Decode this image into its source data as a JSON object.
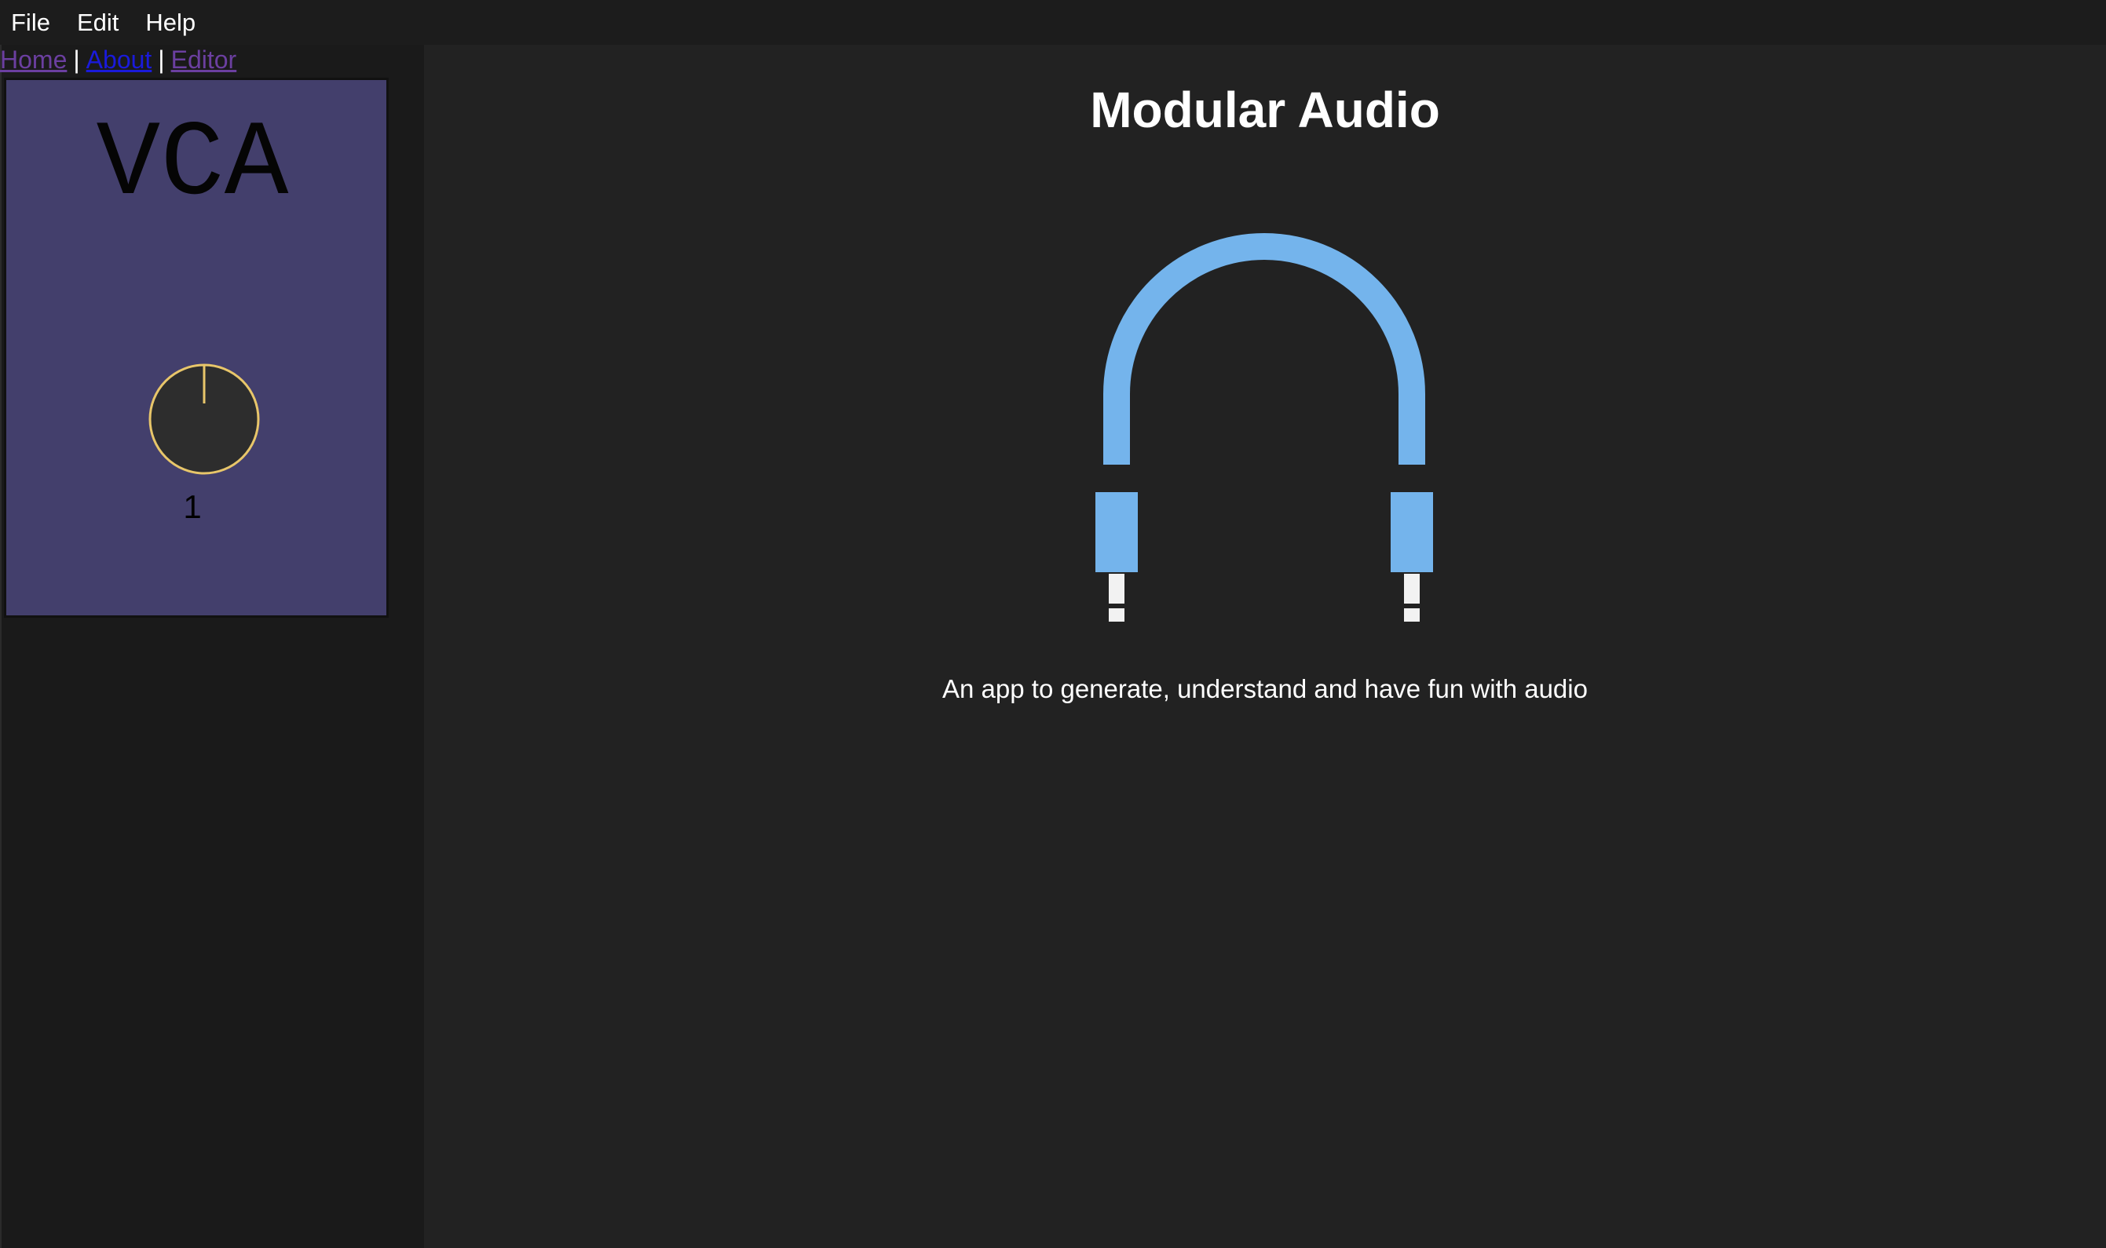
{
  "menu": {
    "items": [
      {
        "label": "File"
      },
      {
        "label": "Edit"
      },
      {
        "label": "Help"
      }
    ]
  },
  "nav": {
    "home": "Home",
    "about": "About",
    "editor": "Editor",
    "separator": "|"
  },
  "module": {
    "title": "VCA",
    "knob_value": "1",
    "colors": {
      "panel": "#433f6c",
      "knob_ring": "#e8c66a",
      "knob_fill": "#2d2d2d"
    }
  },
  "main": {
    "heading": "Modular Audio",
    "tagline": "An app to generate, understand and have fun with audio",
    "logo_icon": "patch-cable-icon",
    "colors": {
      "cable": "#74b4ec",
      "plug_tip": "#f2f2f2"
    }
  }
}
